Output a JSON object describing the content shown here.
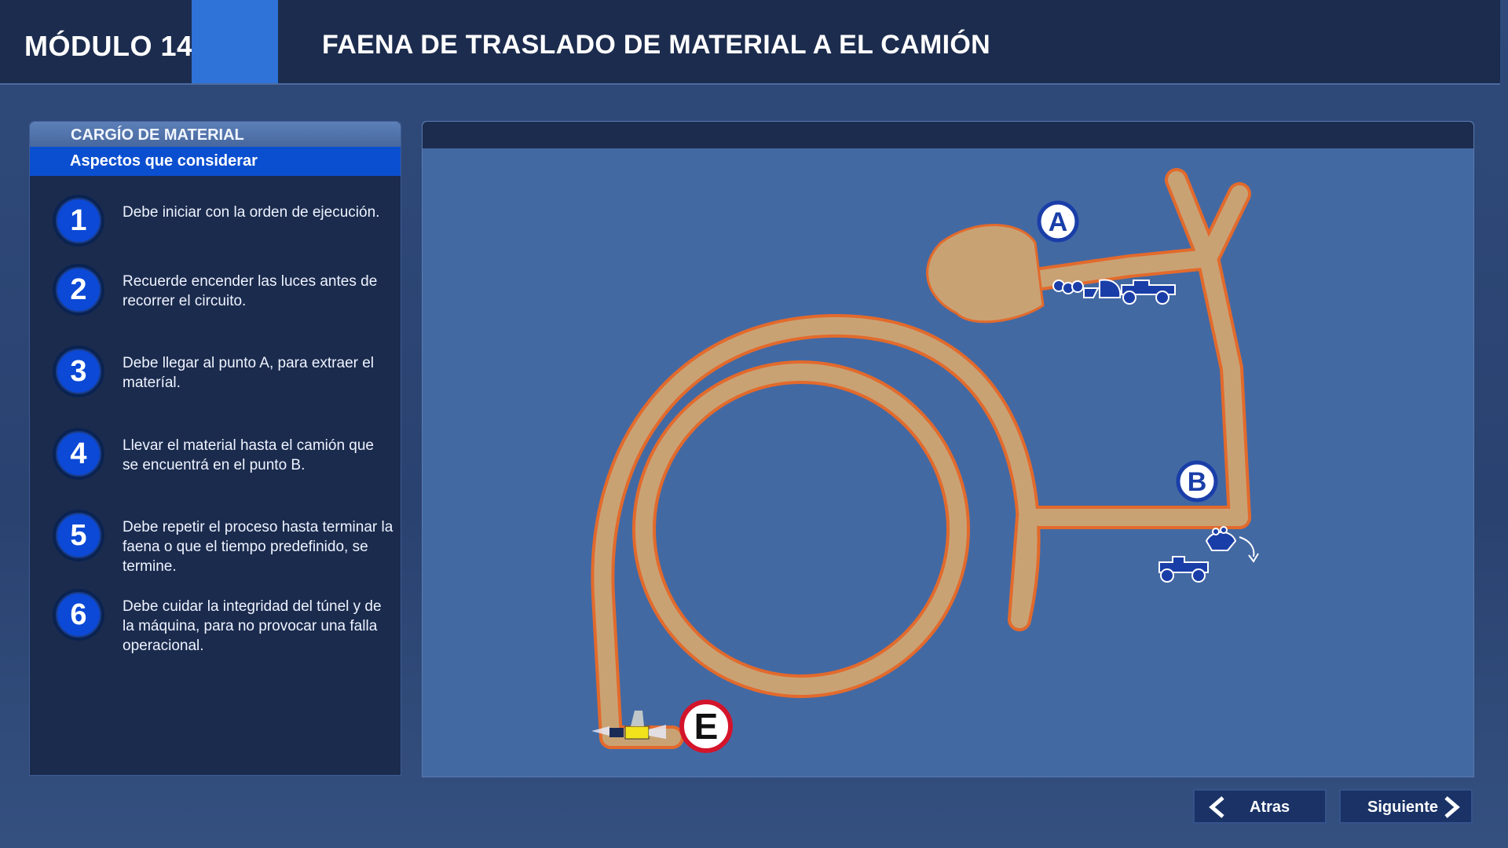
{
  "header": {
    "module": "MÓDULO 14",
    "title": "FAENA DE TRASLADO DE MATERIAL A EL CAMIÓN"
  },
  "panel": {
    "title": "CARGÍO DE MATERIAL",
    "subtitle": "Aspectos que considerar",
    "steps": [
      {
        "number": "1",
        "text": "Debe iniciar con la orden de ejecución."
      },
      {
        "number": "2",
        "text": "Recuerde encender las luces antes de recorrer el circuito."
      },
      {
        "number": "3",
        "text": "Debe llegar al punto A, para extraer el materíal."
      },
      {
        "number": "4",
        "text": "Llevar el material hasta el camión que se encuentrá en el punto B."
      },
      {
        "number": "5",
        "text": "Debe repetir el proceso hasta terminar la faena o que el tiempo predefinido, se termine."
      },
      {
        "number": "6",
        "text": "Debe cuidar la integridad del túnel y de la máquina, para no provocar una falla operacional."
      }
    ]
  },
  "map": {
    "point_a": "A",
    "point_b": "B",
    "point_e": "E",
    "icons": [
      "loader-scoop-icon",
      "truck-icon",
      "loader-icon",
      "dump-icon"
    ]
  },
  "nav": {
    "back": "Atras",
    "next": "Siguiente"
  },
  "colors": {
    "header_bg": "#1c2c4e",
    "accent": "#2f73d9",
    "step_circle": "#0b49d6",
    "map_bg": "#4369a3",
    "road": "#c9a274",
    "road_border": "#e26a2c",
    "marker": "#1a3ea8"
  }
}
